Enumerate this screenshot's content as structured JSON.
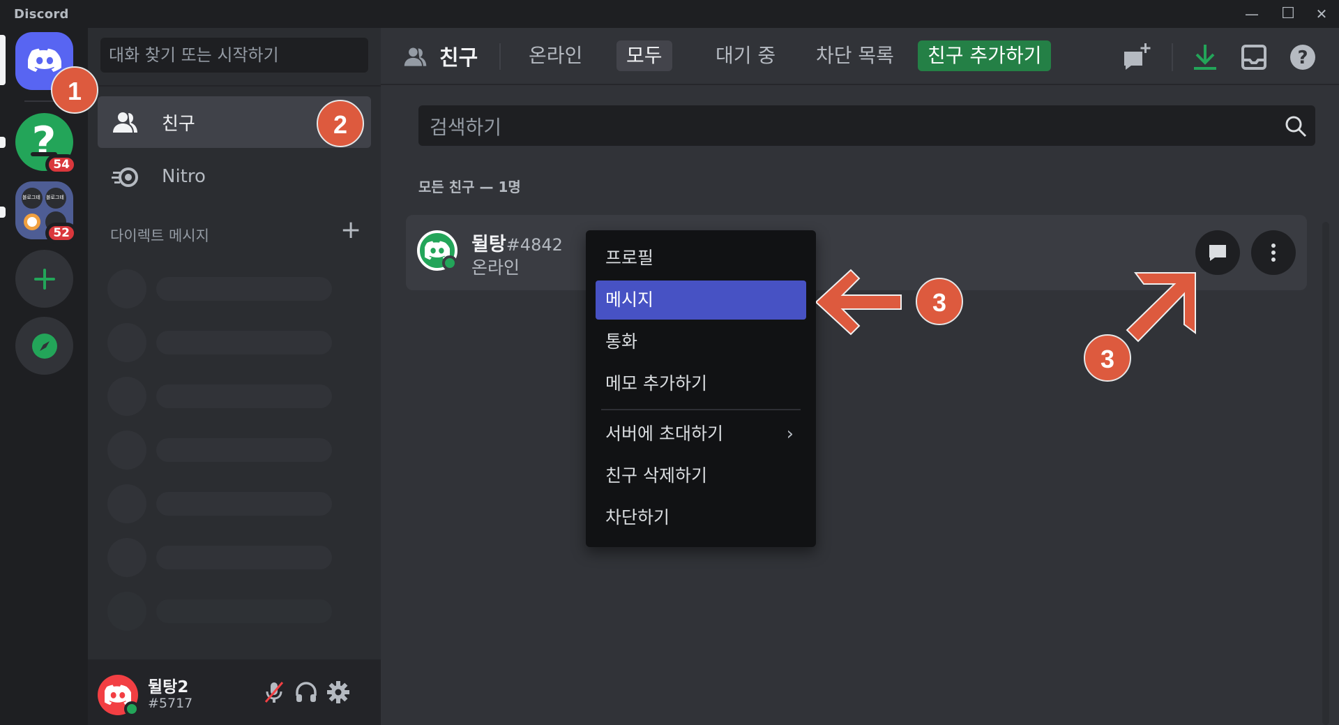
{
  "window": {
    "title": "Discord",
    "controls": {
      "minimize": "—",
      "maximize": "☐",
      "close": "✕"
    }
  },
  "rail": {
    "servers": [
      {
        "name": "help-server",
        "badge": "54"
      },
      {
        "name": "blog-server",
        "badge": "52",
        "icon_text": "블로그테"
      }
    ]
  },
  "sidebar": {
    "search_placeholder": "대화 찾기 또는 시작하기",
    "nav": [
      {
        "label": "친구",
        "active": true
      },
      {
        "label": "Nitro",
        "active": false
      }
    ],
    "dm_header": "다이렉트 메시지",
    "dm_add": "+"
  },
  "user": {
    "name": "뒬탕2",
    "tag": "#5717",
    "status_color": "#23a559"
  },
  "topbar": {
    "title": "친구",
    "tabs": [
      {
        "label": "온라인"
      },
      {
        "label": "모두"
      },
      {
        "label": "대기 중"
      },
      {
        "label": "차단 목록"
      }
    ],
    "add_friend": "친구 추가하기"
  },
  "main": {
    "search_placeholder": "검색하기",
    "list_header": "모든 친구 — 1명",
    "friend": {
      "name": "뒬탕",
      "tag": "#4842",
      "status": "온라인"
    }
  },
  "context_menu": {
    "items": [
      "프로필",
      "메시지",
      "통화",
      "메모 추가하기",
      "서버에 초대하기",
      "친구 삭제하기",
      "차단하기"
    ],
    "highlighted": "메시지",
    "submenu_chevron": "›"
  },
  "annotations": {
    "step1": "1",
    "step2": "2",
    "step3a": "3",
    "step3b": "3"
  },
  "colors": {
    "accent": "#5865f2",
    "green": "#23a559",
    "annotation": "#dd5a3e",
    "menu_highlight": "#4752c4"
  }
}
